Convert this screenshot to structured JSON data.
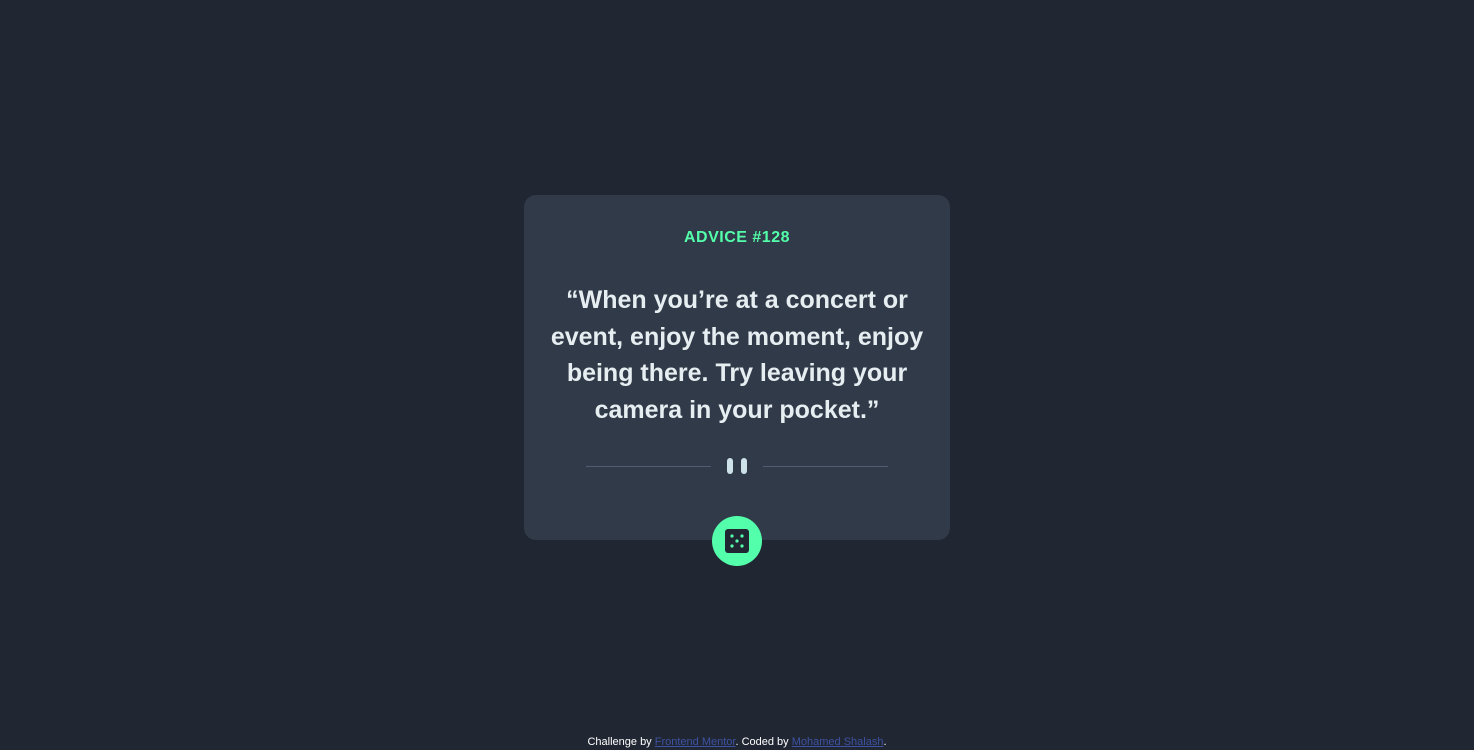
{
  "card": {
    "advice_id": "ADVICE #128",
    "quote": "“When you’re at a concert or event, enjoy the moment, enjoy being there. Try leaving your camera in your pocket.”"
  },
  "dice_button": {
    "icon": "dice-icon"
  },
  "footer": {
    "prefix": "Challenge by ",
    "challenge_link": "Frontend Mentor",
    "middle": ". Coded by ",
    "author_link": "Mohamed Shalash",
    "suffix": "."
  },
  "colors": {
    "background": "#202632",
    "card": "#313a48",
    "accent": "#53ffaa",
    "text": "#cee3e9",
    "divider": "#4f5d74",
    "link": "#3e52a3"
  }
}
